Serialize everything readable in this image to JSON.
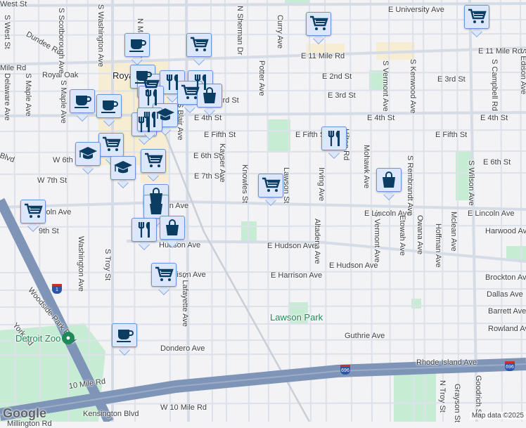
{
  "map": {
    "colors": {
      "background": "#f3f2f5",
      "road": "#dfe3ea",
      "highway": "#7f95b8",
      "park": "#c6ecd3",
      "downtown": "#f6edd2",
      "marker_fill": "#dde7fb",
      "marker_border": "#6c94dc",
      "icon": "#0b3d63"
    },
    "labels": [
      "E University Ave",
      "E 11 Mile Rd",
      "E 11 Mile Rd",
      "Mile Rd",
      "Royal Oak",
      "Royal Oak",
      "E 2nd St",
      "E 3rd St",
      "E 3rd St",
      "E 3rd St",
      "E 4th St",
      "E 4th St",
      "E 4th St",
      "E Fifth St",
      "E Fifth St",
      "E Fifth St",
      "E 6th St",
      "E 6th St",
      "W 6th",
      "E 7th St",
      "W 7th St",
      "Blvd",
      "E Lincoln Ave",
      "E Lincoln Ave",
      "Lincoln Ave",
      "coln Ave",
      "9th St",
      "Harwood Ave",
      "E Hudson Ave",
      "E Hudson Ave",
      "Hudson Ave",
      "E Harrison Ave",
      "Harrison Ave",
      "Brockton Ave",
      "Dallas Ave",
      "Barrett Ave",
      "Rowland Ave",
      "Guthrie Ave",
      "Dondero Ave",
      "Rhode Island Ave",
      "10 Mile Rd",
      "W 10 Mile Rd",
      "Kensington Blvd",
      "Millington Rd",
      "Woodside Park Blvd",
      "York Rd",
      "Dundee Rd",
      "N Sherman Dr",
      "Curry Ave",
      "Potter Ave",
      "Kayser Ave",
      "Knowles St",
      "Lawson St",
      "Irving Ave",
      "Altadena Ave",
      "Mohawk Ave",
      "S Rembrandt Ave",
      "S Vermont Ave",
      "Etowah Ave",
      "Owana Ave",
      "Hoffman Ave",
      "Mclean Ave",
      "S Wilson Ave",
      "S Campbell Rd",
      "S Edison Ave",
      "S Kenwood Ave",
      "S Vermont Ave",
      "S Blair Ave",
      "S Troy St",
      "S Washington Ave",
      "Washington Ave",
      "S Lafayette Ave",
      "Delaware Ave",
      "S Maple Ave",
      "S Maple Ave",
      "S West St",
      "N Maple Ave",
      "N Troy St",
      "Grayson St",
      "Goodrich St",
      "Hilton Rd",
      "S Scotborough Ave",
      "West St"
    ],
    "places": [
      {
        "name": "Detroit Zoo",
        "icon": "paw-icon"
      },
      {
        "name": "Lawson Park",
        "icon": "park-icon"
      }
    ],
    "highway_shields": [
      "696",
      "696",
      "1"
    ],
    "markers": [
      "shopping-cart-icon",
      "shopping-cart-icon",
      "coffee-icon",
      "shopping-cart-icon",
      "coffee-icon",
      "shopping-cart-icon",
      "restaurant-icon",
      "restaurant-icon",
      "shopping-cart-icon",
      "shopping-bag-icon",
      "coffee-icon",
      "coffee-icon",
      "restaurant-icon",
      "school-icon",
      "restaurant-icon",
      "restaurant-icon",
      "shopping-cart-icon",
      "school-icon",
      "shopping-cart-icon",
      "school-icon",
      "shopping-bag-icon",
      "shopping-bag-icon",
      "restaurant-icon",
      "shopping-bag-icon",
      "shopping-cart-icon",
      "shopping-cart-icon",
      "restaurant-icon",
      "shopping-bag-icon",
      "shopping-cart-icon",
      "coffee-icon"
    ],
    "logo": "Google",
    "attribution": "Map data ©2025"
  }
}
